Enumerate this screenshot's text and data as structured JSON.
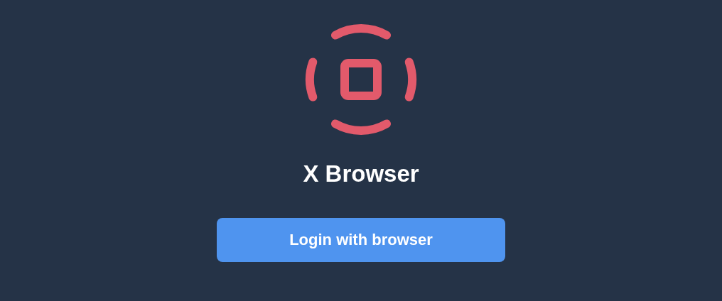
{
  "app": {
    "title": "X Browser"
  },
  "login_button": {
    "label": "Login with browser"
  }
}
